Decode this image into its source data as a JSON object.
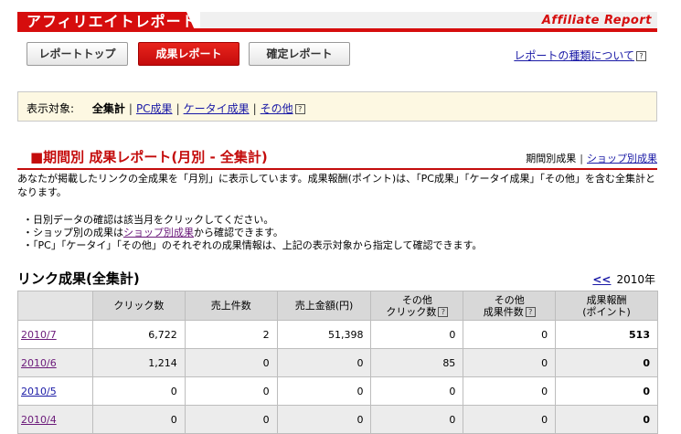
{
  "header": {
    "title_jp": "アフィリエイトレポート",
    "title_en": "Affiliate Report"
  },
  "tabs": [
    {
      "label": "レポートトップ",
      "active": false
    },
    {
      "label": "成果レポート",
      "active": true
    },
    {
      "label": "確定レポート",
      "active": false
    }
  ],
  "types_link": "レポートの種類について",
  "filter": {
    "label": "表示対象:",
    "current": "全集計",
    "links": [
      "PC成果",
      "ケータイ成果",
      "その他"
    ]
  },
  "section": {
    "title": "■期間別 成果レポート(月別 - 全集計)",
    "right_label": "期間別成果",
    "right_link": "ショップ別成果",
    "description": "あなたが掲載したリンクの全成果を「月別」に表示しています。成果報酬(ポイント)は、「PC成果」「ケータイ成果」「その他」を含む全集計となります。",
    "bullet1": "日別データの確認は該当月をクリックしてください。",
    "bullet2_pre": "ショップ別の成果は",
    "bullet2_link": "ショップ別成果",
    "bullet2_post": "から確認できます。",
    "bullet3": "「PC」「ケータイ」「その他」のそれぞれの成果情報は、上記の表示対象から指定して確認できます。"
  },
  "table": {
    "title": "リンク成果(全集計)",
    "prev_symbol": "<<",
    "year": "2010年",
    "headers": {
      "clicks": "クリック数",
      "sales_count": "売上件数",
      "sales_amount": "売上金額(円)",
      "other_clicks_1": "その他",
      "other_clicks_2": "クリック数",
      "other_sales_1": "その他",
      "other_sales_2": "成果件数",
      "reward_1": "成果報酬",
      "reward_2": "(ポイント)"
    },
    "rows": [
      {
        "month": "2010/7",
        "clicks": "6,722",
        "sales_count": "2",
        "sales_amount": "51,398",
        "other_clicks": "0",
        "other_sales": "0",
        "reward": "513"
      },
      {
        "month": "2010/6",
        "clicks": "1,214",
        "sales_count": "0",
        "sales_amount": "0",
        "other_clicks": "85",
        "other_sales": "0",
        "reward": "0"
      },
      {
        "month": "2010/5",
        "clicks": "0",
        "sales_count": "0",
        "sales_amount": "0",
        "other_clicks": "0",
        "other_sales": "0",
        "reward": "0"
      },
      {
        "month": "2010/4",
        "clicks": "0",
        "sales_count": "0",
        "sales_amount": "0",
        "other_clicks": "0",
        "other_sales": "0",
        "reward": "0"
      }
    ]
  },
  "colors": {
    "brand_red": "#d60d0d",
    "filter_bg": "#fdf8e2",
    "link": "#1a1aa6"
  }
}
